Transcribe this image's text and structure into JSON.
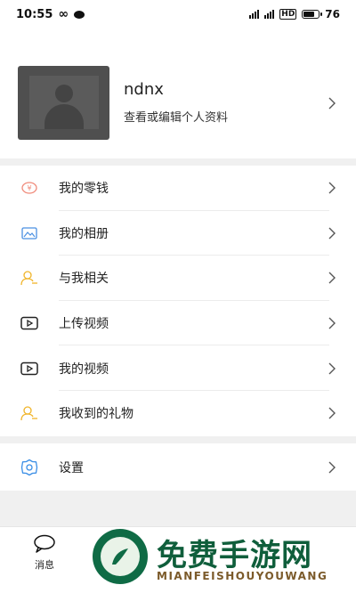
{
  "status_bar": {
    "time": "10:55",
    "battery": "76",
    "battery_level": 0.76
  },
  "profile": {
    "name": "ndnx",
    "subtitle": "查看或编辑个人资料"
  },
  "menu": [
    {
      "label": "我的零钱",
      "icon": "yuan-circle-icon"
    },
    {
      "label": "我的相册",
      "icon": "photo-album-icon"
    },
    {
      "label": "与我相关",
      "icon": "user-related-icon"
    },
    {
      "label": "上传视频",
      "icon": "upload-video-icon"
    },
    {
      "label": "我的视频",
      "icon": "my-video-icon"
    },
    {
      "label": "我收到的礼物",
      "icon": "gift-received-icon"
    }
  ],
  "settings": {
    "label": "设置",
    "icon": "gear-icon"
  },
  "tabbar": [
    {
      "label": "消息",
      "icon": "chat-bubble-icon"
    },
    {
      "label": "",
      "icon": ""
    },
    {
      "label": "",
      "icon": ""
    },
    {
      "label": "",
      "icon": ""
    }
  ],
  "watermark": {
    "title": "免费手游网",
    "subtitle": "MIANFEISHOUYOUWANG"
  },
  "colors": {
    "accent": "#3a8ee6",
    "section_gap": "#f0f0f0",
    "watermark_green": "#0f5e3b"
  }
}
